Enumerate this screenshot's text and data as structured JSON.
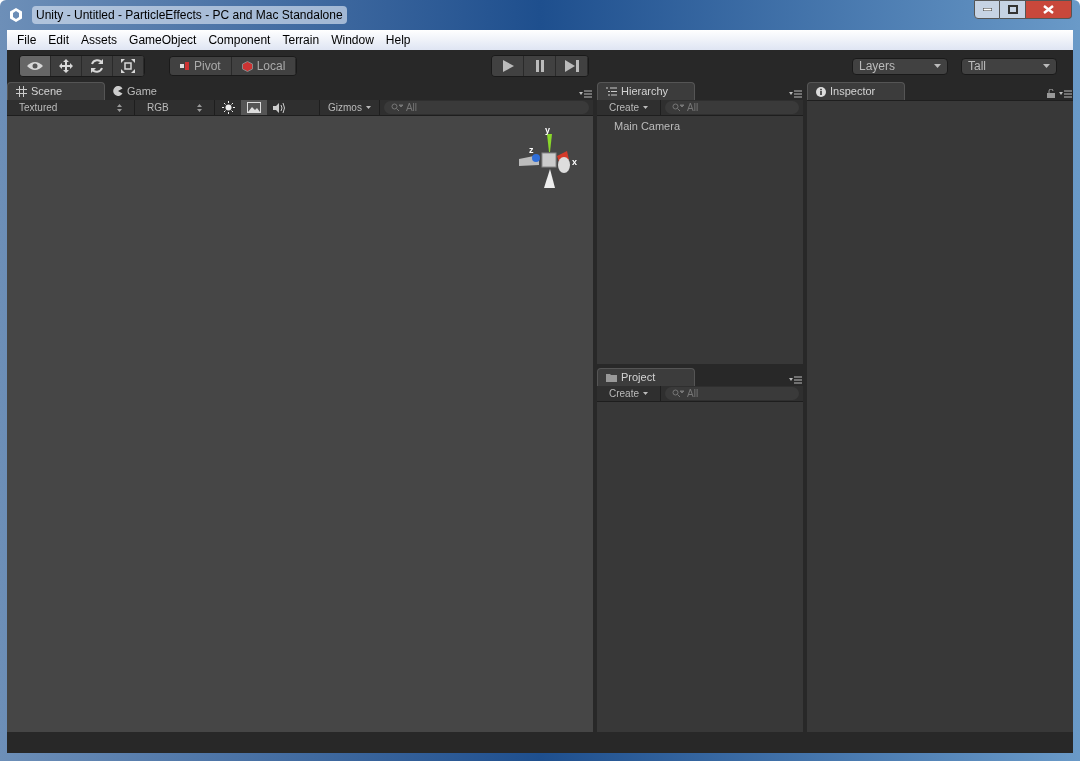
{
  "window": {
    "title": "Unity - Untitled - ParticleEffects - PC and Mac Standalone"
  },
  "menu": [
    "File",
    "Edit",
    "Assets",
    "GameObject",
    "Component",
    "Terrain",
    "Window",
    "Help"
  ],
  "tools": [
    {
      "kind": "eye",
      "selected": true
    },
    {
      "kind": "move",
      "selected": false
    },
    {
      "kind": "rotate",
      "selected": false
    },
    {
      "kind": "scale",
      "selected": false
    }
  ],
  "pivot_toggles": [
    {
      "kind": "pivot",
      "label": "Pivot"
    },
    {
      "kind": "local",
      "label": "Local"
    }
  ],
  "playback": [
    {
      "kind": "play",
      "selected": false
    },
    {
      "kind": "pause",
      "selected": false
    },
    {
      "kind": "step",
      "selected": false
    }
  ],
  "dropdowns": [
    "Layers",
    "Tall"
  ],
  "scene_tabs": [
    {
      "kind": "grid",
      "label": "Scene",
      "selected": true
    },
    {
      "kind": "pacman",
      "label": "Game",
      "selected": false
    }
  ],
  "scene_toolbar": {
    "render_mode": "Textured",
    "channel": "RGB",
    "toggles": [
      {
        "kind": "sun",
        "selected": false
      },
      {
        "kind": "image",
        "selected": true
      },
      {
        "kind": "audio",
        "selected": false
      }
    ],
    "gizmos": "Gizmos",
    "search": {
      "placeholder": "All"
    }
  },
  "gizmo_axes": {
    "y": "y",
    "z": "z",
    "x": "x"
  },
  "hierarchy": {
    "tab": "Hierarchy",
    "create": "Create",
    "search": {
      "placeholder": "All"
    },
    "items": [
      "Main Camera"
    ]
  },
  "project": {
    "tab": "Project",
    "create": "Create",
    "search": {
      "placeholder": "All"
    }
  },
  "inspector": {
    "tab": "Inspector"
  }
}
